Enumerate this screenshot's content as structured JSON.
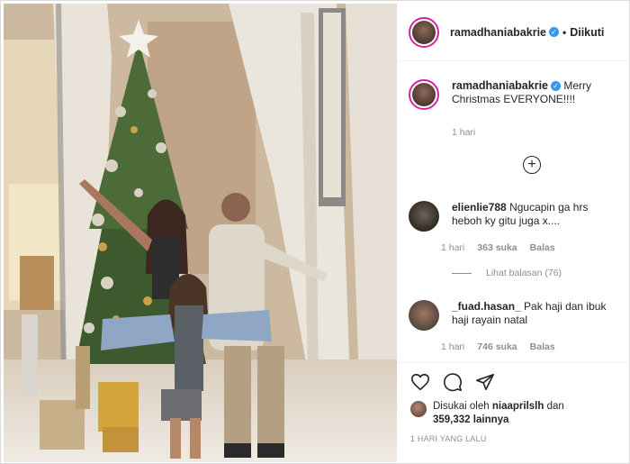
{
  "post": {
    "username": "ramadhaniabakrie",
    "follow_status": "Diikuti",
    "caption": "Merry Christmas EVERYONE!!!!",
    "caption_time": "1 hari",
    "photo_icon": "christmas-photo"
  },
  "comments": [
    {
      "username": "elienlie788",
      "text": "Ngucapin ga hrs heboh ky gitu juga x....",
      "time": "1 hari",
      "likes": "363 suka",
      "reply": "Balas",
      "view_replies": "Lihat balasan (76)"
    },
    {
      "username": "_fuad.hasan_",
      "text": "Pak haji dan ibuk haji rayain natal",
      "time": "1 hari",
      "likes": "746 suka",
      "reply": "Balas"
    }
  ],
  "actions": {
    "like_icon": "heart-icon",
    "comment_icon": "comment-icon",
    "share_icon": "share-icon"
  },
  "likes": {
    "prefix": "Disukai oleh",
    "first_user": "niaaprilslh",
    "conjunction": "dan",
    "count": "359,332",
    "suffix": "lainnya"
  },
  "date_label": "1 HARI YANG LALU",
  "colors": {
    "verified": "#3897f0",
    "muted": "#8e8e8e",
    "text": "#262626"
  }
}
